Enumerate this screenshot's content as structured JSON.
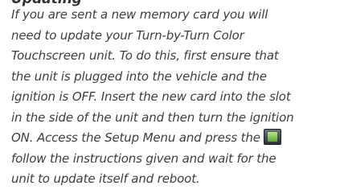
{
  "document": {
    "cut_heading": "Updating",
    "lines": [
      "If you are sent a new memory card you will",
      "need to update your Turn-by-Turn Color",
      "Touchscreen unit. To do this, first ensure that",
      "the unit is plugged into the vehicle and the",
      "ignition is OFF. Insert the new card into the slot",
      "in the side of the unit and then turn the ignition",
      "ON. Access the Setup Menu and press the",
      "follow the instructions given and wait for the",
      "unit to update itself and reboot."
    ],
    "inline_icon": "setup-menu-icon"
  },
  "colors": {
    "text": "#3b3e42",
    "heading": "#2f3236",
    "icon_body": "#3d4349",
    "icon_screen": "#8fcf60"
  }
}
